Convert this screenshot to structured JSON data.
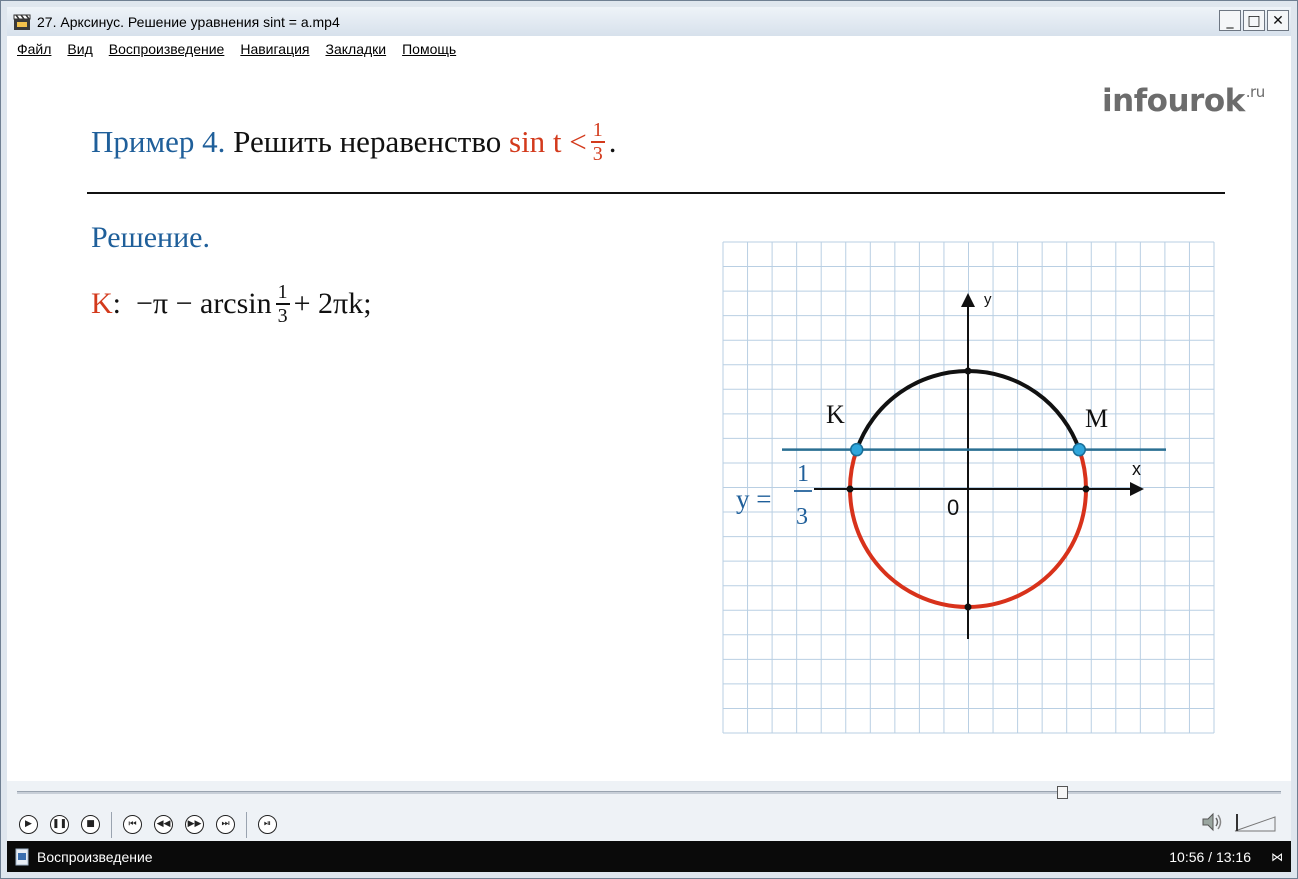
{
  "window": {
    "title": "27. Арксинус. Решение уравнения sint = a.mp4",
    "minimize": "_",
    "maximize": "□",
    "close": "✕"
  },
  "menu": [
    "Файл",
    "Вид",
    "Воспроизведение",
    "Навигация",
    "Закладки",
    "Помощь"
  ],
  "slide": {
    "logo": "infourok",
    "logo_sup": ".ru",
    "heading_prefix": "Пример 4.",
    "heading_text": "Решить неравенство",
    "heading_expr": "sin t <",
    "heading_frac_num": "1",
    "heading_frac_den": "3",
    "heading_end": ".",
    "solution_label": "Решение.",
    "formula_point": "K",
    "formula_colon": ":",
    "formula_expr": "−π − arcsin",
    "formula_frac_num": "1",
    "formula_frac_den": "3",
    "formula_tail": "+ 2πk;",
    "graph": {
      "axis_x": "x",
      "axis_y": "y",
      "origin": "0",
      "point_left": "K",
      "point_right": "M",
      "line_label": "y =",
      "line_frac_num": "1",
      "line_frac_den": "3",
      "line_y_value": 0.3333,
      "colors": {
        "upper_arc": "#111111",
        "lower_arc": "#d8321b",
        "line": "#2a6f92",
        "points": "#2fa6db",
        "grid": "#b9cfe3"
      }
    }
  },
  "player": {
    "seek_progress": 0.827,
    "status": "Воспроизведение",
    "time": "10:56 / 13:16"
  }
}
